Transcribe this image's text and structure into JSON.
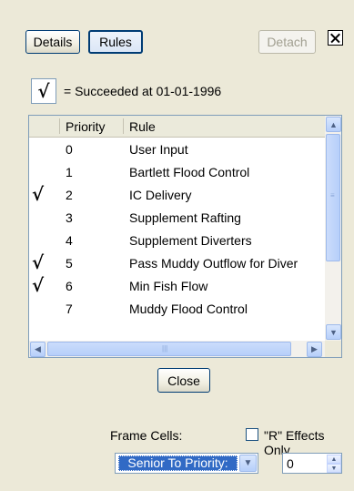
{
  "toolbar": {
    "details_label": "Details",
    "rules_label": "Rules",
    "detach_label": "Detach"
  },
  "legend": {
    "text": "= Succeeded at 01-01-1996"
  },
  "table": {
    "columns": [
      "Priority",
      "Rule"
    ],
    "rows": [
      {
        "checked": false,
        "priority": "0",
        "rule": "User Input"
      },
      {
        "checked": false,
        "priority": "1",
        "rule": "Bartlett Flood Control"
      },
      {
        "checked": true,
        "priority": "2",
        "rule": "IC Delivery"
      },
      {
        "checked": false,
        "priority": "3",
        "rule": "Supplement Rafting"
      },
      {
        "checked": false,
        "priority": "4",
        "rule": "Supplement Diverters"
      },
      {
        "checked": true,
        "priority": "5",
        "rule": "Pass Muddy Outflow for Diver"
      },
      {
        "checked": true,
        "priority": "6",
        "rule": "Min Fish Flow"
      },
      {
        "checked": false,
        "priority": "7",
        "rule": "Muddy Flood Control"
      }
    ]
  },
  "close_label": "Close",
  "frame_cells": {
    "label": "Frame Cells:",
    "r_effects_label": "\"R\" Effects Only",
    "r_effects_checked": false,
    "mode_selected": "Senior To Priority:",
    "priority_value": "0"
  },
  "icons": {
    "check": "checkmark-icon",
    "close": "close-x-icon"
  }
}
